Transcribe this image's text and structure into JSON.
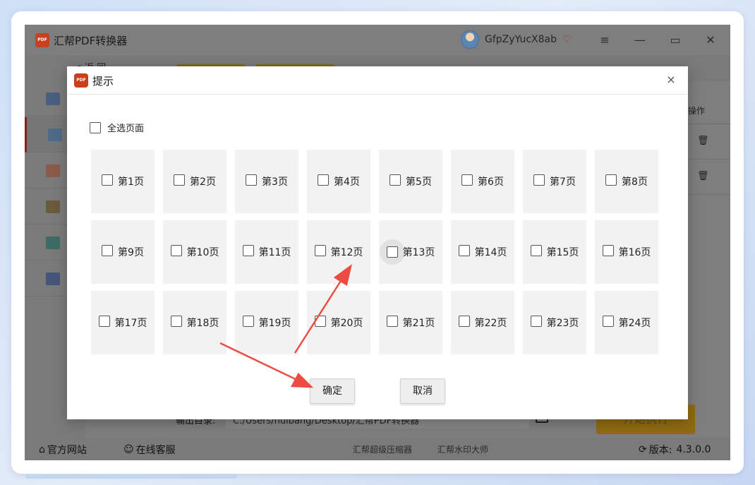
{
  "app": {
    "title": "汇帮PDF转换器",
    "logo_text": "PDF",
    "username": "GfpZyYucX8ab",
    "back_label": "< 返 回",
    "actions_header": "操作",
    "output_dir_label": "输出目录:",
    "output_dir_value": "C:/Users/huibang/Desktop/汇帮PDF转换器",
    "start_button": "开始执行"
  },
  "footer": {
    "website": "官方网站",
    "support": "在线客服",
    "link1": "汇帮超级压缩器",
    "link2": "汇帮水印大师",
    "version_label": "版本:",
    "version": "4.3.0.0"
  },
  "dialog": {
    "title": "提示",
    "logo_text": "PDF",
    "close": "×",
    "select_all": "全选页面",
    "pages": [
      "第1页",
      "第2页",
      "第3页",
      "第4页",
      "第5页",
      "第6页",
      "第7页",
      "第8页",
      "第9页",
      "第10页",
      "第11页",
      "第12页",
      "第13页",
      "第14页",
      "第15页",
      "第16页",
      "第17页",
      "第18页",
      "第19页",
      "第20页",
      "第21页",
      "第22页",
      "第23页",
      "第24页"
    ],
    "confirm": "确定",
    "cancel": "取消"
  },
  "icons": {
    "window": [
      "menu-icon",
      "minimize-icon",
      "maximize-icon",
      "close-icon"
    ],
    "sidebar": [
      "word-icon",
      "excel-icon",
      "ppt-icon",
      "image-icon",
      "txt-icon",
      "book-icon"
    ]
  },
  "colors": {
    "accent": "#e8403a",
    "logo": "#d9481e",
    "start_button": "#f0a500"
  }
}
